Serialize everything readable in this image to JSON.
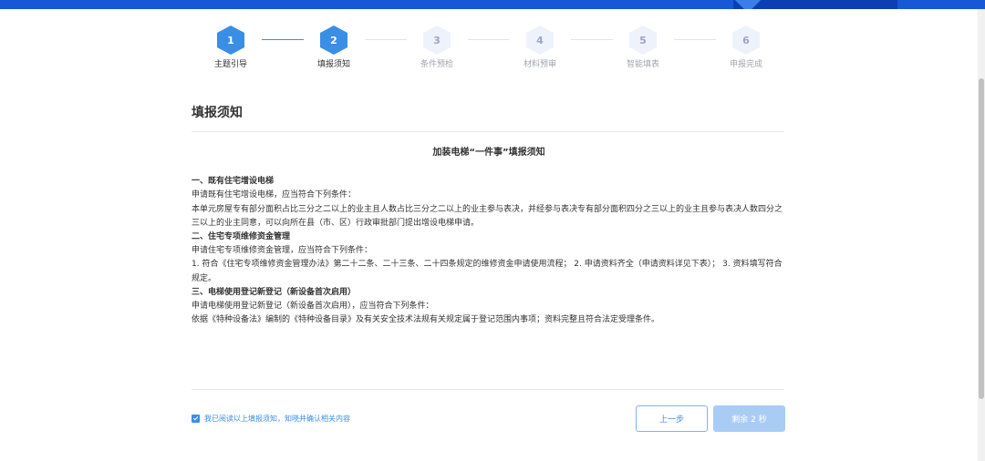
{
  "steps": [
    {
      "number": "1",
      "label": "主题引导",
      "state": "done"
    },
    {
      "number": "2",
      "label": "填报须知",
      "state": "current"
    },
    {
      "number": "3",
      "label": "条件预检",
      "state": "pending"
    },
    {
      "number": "4",
      "label": "材料预审",
      "state": "pending"
    },
    {
      "number": "5",
      "label": "智能填表",
      "state": "pending"
    },
    {
      "number": "6",
      "label": "申报完成",
      "state": "pending"
    }
  ],
  "page_title": "填报须知",
  "notice": {
    "title": "加装电梯“一件事”填报须知",
    "sections": [
      {
        "heading": "一、既有住宅增设电梯",
        "lines": [
          "申请既有住宅增设电梯，应当符合下列条件：",
          "本单元房屋专有部分面积占比三分之二以上的业主且人数占比三分之二以上的业主参与表决，并经参与表决专有部分面积四分之三以上的业主且参与表决人数四分之三以上的业主同意，可以向所在县（市、区）行政审批部门提出增设电梯申请。"
        ]
      },
      {
        "heading": "二、住宅专项维修资金管理",
        "lines": [
          "申请住宅专项维修资金管理，应当符合下列条件：",
          "1. 符合《住宅专项维修资金管理办法》第二十二条、二十三条、二十四条规定的维修资金申请使用流程； 2. 申请资料齐全（申请资料详见下表）； 3. 资料填写符合规定。"
        ]
      },
      {
        "heading": "三、电梯使用登记新登记（新设备首次启用）",
        "lines": [
          "申请电梯使用登记新登记（新设备首次启用），应当符合下列条件：",
          "依据《特种设备法》编制的《特种设备目录》及有关安全技术法规有关规定属于登记范围内事项；资料完整且符合法定受理条件。"
        ]
      }
    ]
  },
  "agreement": {
    "checked": true,
    "text": "我已阅读以上填报须知，知晓并确认相关内容"
  },
  "buttons": {
    "prev": "上一步",
    "next": "剩余 2 秒"
  },
  "colors": {
    "primary": "#3a8ee6",
    "header": "#1758d6",
    "disabled_button": "#a9ccf5"
  }
}
